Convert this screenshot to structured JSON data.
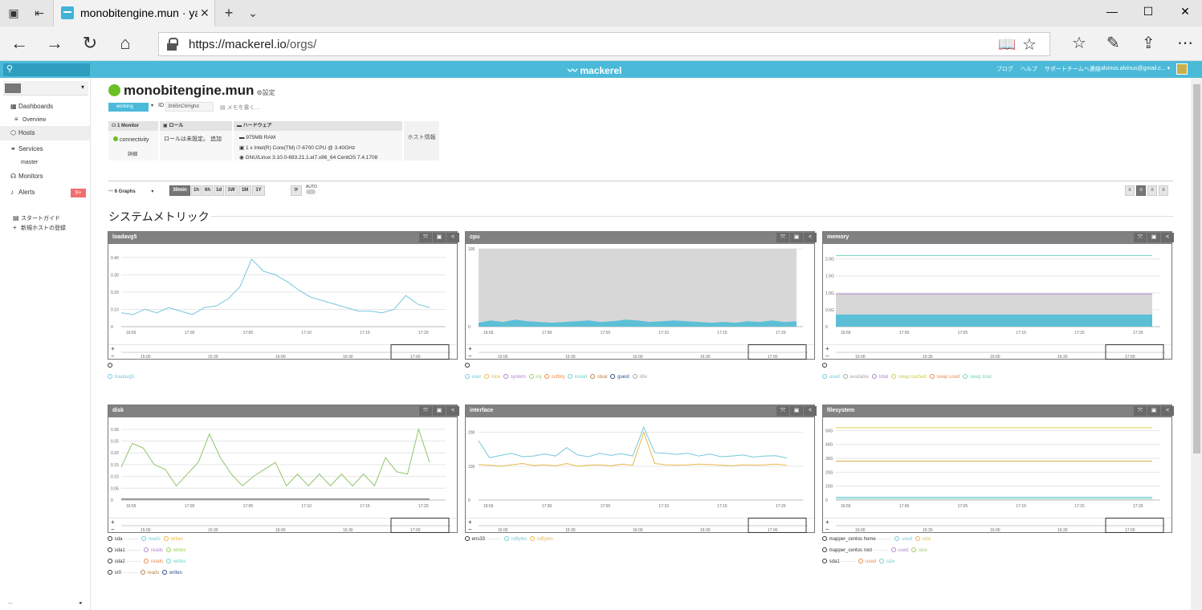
{
  "browser": {
    "tab_title": "monobitengine.mun · ya",
    "url_host": "https://mackerel.io",
    "url_path": "/orgs/"
  },
  "app": {
    "logo": "mackerel",
    "links": [
      "ブログ",
      "ヘルプ",
      "サポートチームへ連絡"
    ],
    "user": "alvinus.alvinus@gmail.c..."
  },
  "sidebar": {
    "items": [
      {
        "label": "Dashboards",
        "icon": "dashboard-icon"
      },
      {
        "label": "Overview",
        "icon": "list-icon"
      },
      {
        "label": "Hosts",
        "icon": "hosts-icon"
      },
      {
        "label": "Services",
        "icon": "services-icon"
      },
      {
        "label": "master",
        "icon": ""
      },
      {
        "label": "Monitors",
        "icon": "monitors-icon"
      },
      {
        "label": "Alerts",
        "icon": "bell-icon"
      }
    ],
    "alerts_badge": "9+",
    "guide": "スタートガイド",
    "new_host": "新規ホストの登録",
    "bottom_left": "...",
    "bottom_right": "◂"
  },
  "host": {
    "name": "monobitengine.mun",
    "settings": "設定",
    "status": "working",
    "id_label": "ID",
    "id_value": "3h65hC6Hghd",
    "memo": "メモを書く...",
    "monitor_header": "1 Monitor",
    "monitor_item": "connectivity",
    "monitor_detail": "詳細",
    "role_header": "ロール",
    "role_text": "ロールは未設定。 追加",
    "hw_header": "ハードウェア",
    "hw_ram": "975MB RAM",
    "hw_cpu": "1 x Intel(R) Core(TM) i7-6700 CPU @ 3.40GHz",
    "hw_os": "GNU/Linux 3.10.0-693.21.1.el7.x86_64 CentOS 7.4.1708",
    "host_info": "ホスト情報"
  },
  "controls": {
    "graphs": "6 Graphs",
    "ranges": [
      "30min",
      "1h",
      "6h",
      "1d",
      "1W",
      "1M",
      "1Y"
    ],
    "active_range": "30min",
    "auto": "AUTO"
  },
  "section_title": "システムメトリック",
  "colors": {
    "accent": "#4bbad9",
    "panel_header": "#818181"
  },
  "panels": [
    {
      "title": "loadavg5",
      "legend": [
        {
          "host": "",
          "items": [
            {
              "n": "loadavg5",
              "c": "#76c8dc"
            }
          ]
        }
      ]
    },
    {
      "title": "cpu",
      "legend": [
        {
          "host": "",
          "items": [
            {
              "n": "user",
              "c": "#76c8dc"
            },
            {
              "n": "nice",
              "c": "#e8b84a"
            },
            {
              "n": "system",
              "c": "#b084cc"
            },
            {
              "n": "irq",
              "c": "#9ccd5a"
            },
            {
              "n": "softirq",
              "c": "#ef8a4b"
            },
            {
              "n": "iowait",
              "c": "#6fd3c2"
            },
            {
              "n": "steal",
              "c": "#b9834c"
            },
            {
              "n": "guest",
              "c": "#2a4c8a"
            },
            {
              "n": "idle",
              "c": "#aaaaaa"
            }
          ]
        }
      ]
    },
    {
      "title": "memory",
      "legend": [
        {
          "host": "",
          "items": [
            {
              "n": "used",
              "c": "#76c8dc"
            },
            {
              "n": "available",
              "c": "#aaaaaa"
            },
            {
              "n": "total",
              "c": "#b084cc"
            },
            {
              "n": "swap cached",
              "c": "#c8cd4a"
            },
            {
              "n": "swap used",
              "c": "#ef8a4b"
            },
            {
              "n": "swap total",
              "c": "#6fd3c2"
            }
          ]
        }
      ]
    },
    {
      "title": "disk",
      "legend": [
        {
          "host": "sda",
          "items": [
            {
              "n": "reads",
              "c": "#76c8dc"
            },
            {
              "n": "writes",
              "c": "#e8b84a"
            }
          ]
        },
        {
          "host": "sda1",
          "items": [
            {
              "n": "reads",
              "c": "#b084cc"
            },
            {
              "n": "writes",
              "c": "#9ccd5a"
            }
          ]
        },
        {
          "host": "sda2",
          "items": [
            {
              "n": "reads",
              "c": "#ef8a4b"
            },
            {
              "n": "writes",
              "c": "#6fd3c2"
            }
          ]
        },
        {
          "host": "sr0",
          "items": [
            {
              "n": "reads",
              "c": "#b9834c"
            },
            {
              "n": "writes",
              "c": "#2a4c8a"
            }
          ]
        }
      ]
    },
    {
      "title": "interface",
      "legend": [
        {
          "host": "ens33",
          "items": [
            {
              "n": "rxBytes",
              "c": "#76c8dc"
            },
            {
              "n": "txBytes",
              "c": "#e8b84a"
            }
          ]
        }
      ]
    },
    {
      "title": "filesystem",
      "legend": [
        {
          "host": "mapper_centos home",
          "items": [
            {
              "n": "used",
              "c": "#76c8dc"
            },
            {
              "n": "size",
              "c": "#e8b84a"
            }
          ]
        },
        {
          "host": "mapper_centos root",
          "items": [
            {
              "n": "used",
              "c": "#b084cc"
            },
            {
              "n": "size",
              "c": "#9ccd5a"
            }
          ]
        },
        {
          "host": "sda1",
          "items": [
            {
              "n": "used",
              "c": "#ef8a4b"
            },
            {
              "n": "size",
              "c": "#6fd3c2"
            }
          ]
        }
      ]
    }
  ],
  "chart_data": [
    {
      "type": "line",
      "title": "loadavg5",
      "x": [
        "16:55",
        "17:00",
        "17:05",
        "17:10",
        "17:15",
        "17:20"
      ],
      "ylim": [
        0,
        0.45
      ],
      "yticks": [
        "0",
        "0.10",
        "0.20",
        "0.30",
        "0.40"
      ],
      "series": [
        {
          "name": "loadavg5",
          "values": [
            0.08,
            0.07,
            0.1,
            0.08,
            0.11,
            0.09,
            0.07,
            0.11,
            0.12,
            0.16,
            0.23,
            0.39,
            0.32,
            0.3,
            0.26,
            0.21,
            0.17,
            0.15,
            0.13,
            0.11,
            0.09,
            0.09,
            0.08,
            0.1,
            0.18,
            0.13,
            0.11
          ]
        }
      ],
      "mini_x": [
        "15:00",
        "15:30",
        "16:00",
        "16:30",
        "17:00"
      ]
    },
    {
      "type": "area",
      "title": "cpu",
      "x": [
        "16:55",
        "17:00",
        "17:05",
        "17:10",
        "17:15",
        "17:20"
      ],
      "ylim": [
        0,
        100
      ],
      "yticks": [
        "0",
        "100"
      ],
      "series": [
        {
          "name": "user",
          "values": [
            5,
            8,
            6,
            9,
            7,
            6,
            5,
            6,
            7,
            8,
            6,
            7,
            9,
            8,
            6,
            7,
            8,
            7,
            6,
            5,
            6,
            5,
            7,
            6,
            8,
            6,
            7
          ]
        },
        {
          "name": "idle",
          "values": [
            92,
            89,
            91,
            88,
            90,
            91,
            92,
            91,
            90,
            89,
            91,
            90,
            88,
            89,
            91,
            90,
            89,
            90,
            91,
            92,
            91,
            92,
            90,
            91,
            89,
            91,
            90
          ]
        }
      ],
      "mini_x": [
        "15:00",
        "15:30",
        "16:00",
        "16:30",
        "17:00"
      ]
    },
    {
      "type": "area",
      "title": "memory",
      "x": [
        "16:55",
        "17:00",
        "17:05",
        "17:10",
        "17:15",
        "17:20"
      ],
      "ylim": [
        0,
        2.3
      ],
      "yticks": [
        "0",
        "0.5G",
        "1.0G",
        "1.5G",
        "2.0G"
      ],
      "series": [
        {
          "name": "used",
          "values": [
            0.36
          ]
        },
        {
          "name": "total",
          "values": [
            0.97
          ]
        },
        {
          "name": "swap total",
          "values": [
            2.1
          ]
        }
      ],
      "mini_x": [
        "15:00",
        "15:30",
        "16:00",
        "16:30",
        "17:00"
      ]
    },
    {
      "type": "line",
      "title": "disk",
      "x": [
        "16:55",
        "17:00",
        "17:05",
        "17:10",
        "17:15",
        "17:20"
      ],
      "ylim": [
        0,
        0.33
      ],
      "yticks": [
        "0",
        "0.05",
        "0.10",
        "0.15",
        "0.20",
        "0.25",
        "0.30"
      ],
      "series": [
        {
          "name": "writes",
          "values": [
            0.14,
            0.24,
            0.22,
            0.15,
            0.13,
            0.06,
            0.11,
            0.16,
            0.28,
            0.18,
            0.11,
            0.06,
            0.1,
            0.13,
            0.16,
            0.06,
            0.11,
            0.06,
            0.11,
            0.06,
            0.11,
            0.06,
            0.11,
            0.06,
            0.18,
            0.12,
            0.11,
            0.3,
            0.16
          ]
        }
      ],
      "mini_x": [
        "15:00",
        "15:30",
        "16:00",
        "16:30",
        "17:00"
      ]
    },
    {
      "type": "line",
      "title": "interface",
      "x": [
        "16:55",
        "17:00",
        "17:05",
        "17:10",
        "17:15",
        "17:20"
      ],
      "ylim": [
        0,
        230
      ],
      "yticks": [
        "0",
        "100",
        "200"
      ],
      "series": [
        {
          "name": "rxBytes",
          "values": [
            175,
            125,
            132,
            138,
            128,
            130,
            136,
            130,
            155,
            133,
            128,
            138,
            132,
            137,
            130,
            215,
            140,
            138,
            135,
            138,
            130,
            136,
            128,
            130,
            133,
            127,
            130,
            131,
            124
          ]
        },
        {
          "name": "txBytes",
          "values": [
            105,
            103,
            100,
            104,
            108,
            102,
            104,
            101,
            108,
            100,
            103,
            104,
            101,
            106,
            103,
            200,
            108,
            104,
            103,
            104,
            106,
            105,
            103,
            101,
            104,
            103,
            104,
            106,
            103
          ]
        }
      ],
      "mini_x": [
        "15:00",
        "15:30",
        "16:00",
        "16:30",
        "17:00"
      ]
    },
    {
      "type": "line",
      "title": "filesystem",
      "x": [
        "16:55",
        "17:00",
        "17:05",
        "17:10",
        "17:15",
        "17:20"
      ],
      "ylim": [
        0,
        56
      ],
      "yticks": [
        "0",
        "10G",
        "20G",
        "30G",
        "40G",
        "50G"
      ],
      "series": [
        {
          "name": "size",
          "values": [
            52
          ]
        },
        {
          "name": "size",
          "values": [
            28
          ]
        },
        {
          "name": "used",
          "values": [
            2
          ]
        },
        {
          "name": "used",
          "values": [
            1
          ]
        }
      ],
      "mini_x": [
        "15:00",
        "15:30",
        "16:00",
        "16:30",
        "17:00"
      ]
    }
  ]
}
